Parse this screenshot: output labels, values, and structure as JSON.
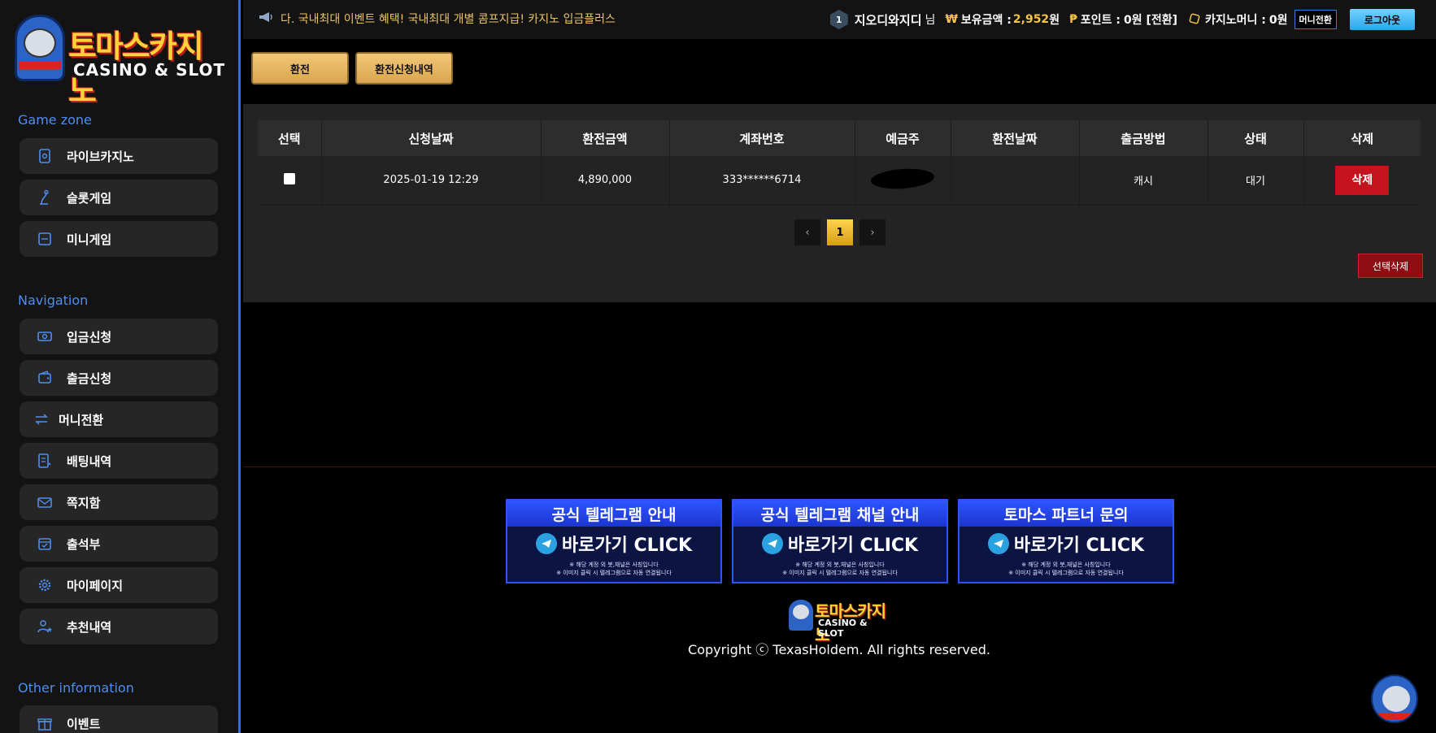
{
  "brand": {
    "logo_text": "토마스카지노",
    "logo_sub": "CASINO & SLOT"
  },
  "sidebar": {
    "sections": [
      {
        "title": "Game zone"
      },
      {
        "title": "Navigation"
      },
      {
        "title": "Other information"
      }
    ],
    "game_zone": [
      {
        "label": "라이브카지노",
        "icon": "cards-icon"
      },
      {
        "label": "슬롯게임",
        "icon": "slot-lever-icon"
      },
      {
        "label": "미니게임",
        "icon": "mini-game-icon"
      }
    ],
    "navigation": [
      {
        "label": "입금신청",
        "icon": "cash-icon"
      },
      {
        "label": "출금신청",
        "icon": "wallet-icon"
      },
      {
        "label": "머니전환",
        "icon": "exchange-arrows-icon"
      },
      {
        "label": "배팅내역",
        "icon": "bet-history-icon"
      },
      {
        "label": "쪽지함",
        "icon": "message-icon"
      },
      {
        "label": "출석부",
        "icon": "calendar-icon"
      },
      {
        "label": "마이페이지",
        "icon": "gear-icon"
      },
      {
        "label": "추천내역",
        "icon": "user-star-icon"
      }
    ],
    "other": [
      {
        "label": "이벤트",
        "icon": "gift-icon"
      }
    ]
  },
  "topbar": {
    "ticker": "다. 국내최대 이벤트 혜택! 국내최대 개별 콤프지급! 카지노 입금플러스",
    "level": "1",
    "username": "지오디와지디",
    "username_suffix": "님",
    "balance_label": "보유금액 :",
    "balance_value": "2,952",
    "balance_unit": "원",
    "point_label": "포인트 :",
    "point_value": "0원 [전환]",
    "casino_money_label": "카지노머니 :",
    "casino_money_value": "0원",
    "convert_button": "머니전환",
    "logout_button": "로그아웃",
    "won_symbol": "₩",
    "point_symbol": "₱"
  },
  "tabs": {
    "exchange": "환전",
    "exchange_history": "환전신청내역"
  },
  "table": {
    "headers": [
      "선택",
      "신청날짜",
      "환전금액",
      "계좌번호",
      "예금주",
      "환전날짜",
      "출금방법",
      "상태",
      "삭제"
    ],
    "rows": [
      {
        "date": "2025-01-19 12:29",
        "amount": "4,890,000",
        "account": "333******6714",
        "holder": "",
        "exchange_date": "",
        "method": "캐시",
        "status": "대기",
        "delete": "삭제"
      }
    ]
  },
  "pagination": {
    "current": "1",
    "prev": "‹",
    "next": "›"
  },
  "bulk_delete": "선택삭제",
  "banners": [
    {
      "title": "공식 텔레그램 안내",
      "cta": "바로가기 CLICK",
      "note1": "※ 해당 계정 외 봇,채널은 사칭입니다",
      "note2": "※ 이미지 클릭 시 텔레그램으로 자동 연결됩니다"
    },
    {
      "title": "공식 텔레그램 채널 안내",
      "cta": "바로가기 CLICK",
      "note1": "※ 해당 계정 외 봇,채널은 사칭입니다",
      "note2": "※ 이미지 클릭 시 텔레그램으로 자동 연결됩니다"
    },
    {
      "title": "토마스 파트너 문의",
      "cta": "바로가기 CLICK",
      "note1": "※ 해당 계정 외 봇,채널은 사칭입니다",
      "note2": "※ 이미지 클릭 시 텔레그램으로 자동 연결됩니다"
    }
  ],
  "footer": {
    "logo_text": "토마스카지노",
    "logo_sub": "CASINO & SLOT",
    "copyright": "Copyright ⓒ TexasHoldem. All rights reserved."
  },
  "colors": {
    "accent_blue": "#4d8ef0",
    "gold": "#f6c343",
    "danger": "#c4131c",
    "sidebar_border": "#2f6fd8"
  }
}
